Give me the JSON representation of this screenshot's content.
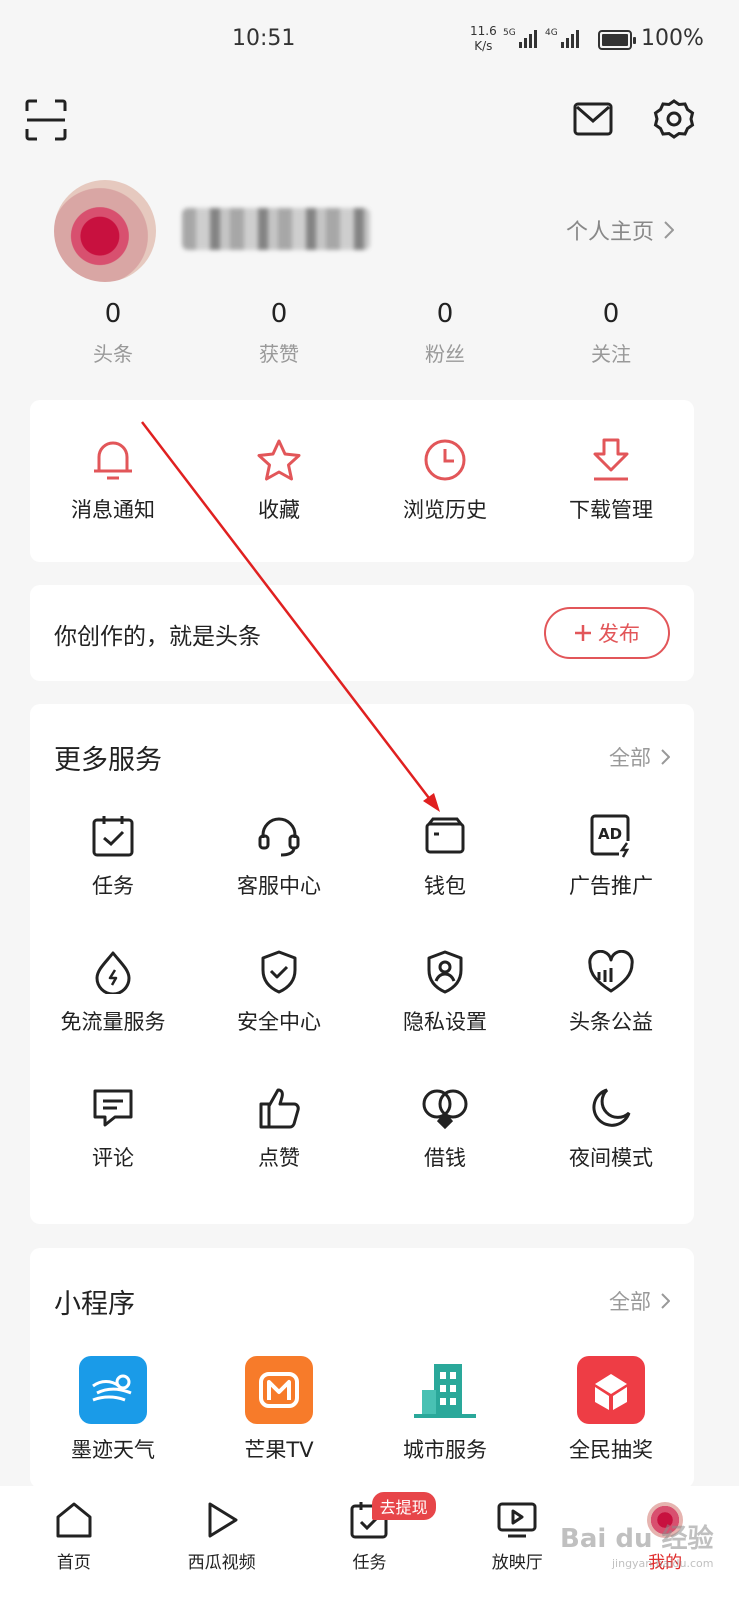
{
  "status_bar": {
    "time": "10:51",
    "net_speed": "11.6",
    "net_unit": "K/s",
    "sim1": "5G",
    "sim2": "4G",
    "battery": "100%"
  },
  "header": {
    "scan_icon": "scan-icon",
    "mail_icon": "mail-icon",
    "settings_icon": "gear-icon"
  },
  "profile": {
    "homepage_link": "个人主页"
  },
  "stats": [
    {
      "value": "0",
      "label": "头条"
    },
    {
      "value": "0",
      "label": "获赞"
    },
    {
      "value": "0",
      "label": "粉丝"
    },
    {
      "value": "0",
      "label": "关注"
    }
  ],
  "quick_actions": [
    {
      "label": "消息通知",
      "icon": "bell-icon"
    },
    {
      "label": "收藏",
      "icon": "star-icon"
    },
    {
      "label": "浏览历史",
      "icon": "clock-icon"
    },
    {
      "label": "下载管理",
      "icon": "download-icon"
    }
  ],
  "publish": {
    "slogan": "你创作的，就是头条",
    "button": "发布"
  },
  "more_services": {
    "title": "更多服务",
    "all": "全部",
    "items": [
      {
        "label": "任务",
        "icon": "calendar-check-icon"
      },
      {
        "label": "客服中心",
        "icon": "headset-icon"
      },
      {
        "label": "钱包",
        "icon": "wallet-icon"
      },
      {
        "label": "广告推广",
        "icon": "ad-icon"
      },
      {
        "label": "免流量服务",
        "icon": "flame-icon"
      },
      {
        "label": "安全中心",
        "icon": "shield-check-icon"
      },
      {
        "label": "隐私设置",
        "icon": "privacy-icon"
      },
      {
        "label": "头条公益",
        "icon": "charity-heart-icon"
      },
      {
        "label": "评论",
        "icon": "comment-icon"
      },
      {
        "label": "点赞",
        "icon": "thumbs-up-icon"
      },
      {
        "label": "借钱",
        "icon": "loan-icon"
      },
      {
        "label": "夜间模式",
        "icon": "moon-icon"
      }
    ]
  },
  "mini_programs": {
    "title": "小程序",
    "all": "全部",
    "items": [
      {
        "label": "墨迹天气",
        "icon": "weather-icon",
        "color": "#1a9be8"
      },
      {
        "label": "芒果TV",
        "icon": "mango-tv-icon",
        "color": "#f77b2a"
      },
      {
        "label": "城市服务",
        "icon": "city-icon",
        "color": "#2aa89a"
      },
      {
        "label": "全民抽奖",
        "icon": "gift-icon",
        "color": "#ee3d45"
      }
    ]
  },
  "tabbar": {
    "items": [
      {
        "label": "首页",
        "icon": "home-icon"
      },
      {
        "label": "西瓜视频",
        "icon": "play-icon"
      },
      {
        "label": "任务",
        "icon": "task-icon",
        "badge": "去提现"
      },
      {
        "label": "放映厅",
        "icon": "tv-icon"
      },
      {
        "label": "我的",
        "icon": "avatar"
      }
    ]
  },
  "watermark": {
    "text": "Bai du 经验",
    "sub": "jingyan.baidu.com"
  },
  "colors": {
    "accent": "#e25659",
    "annotation_arrow": "#e02020"
  }
}
